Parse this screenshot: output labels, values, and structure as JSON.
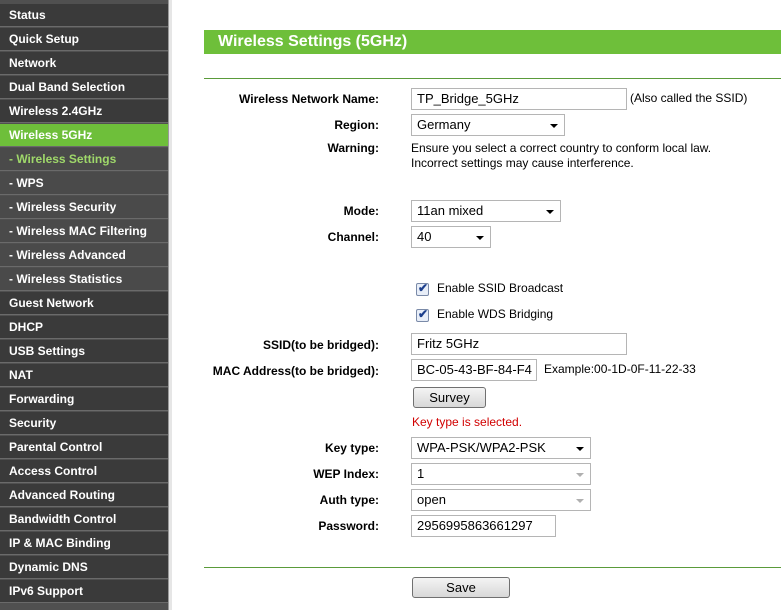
{
  "sidebar": {
    "items": [
      {
        "label": "Status"
      },
      {
        "label": "Quick Setup"
      },
      {
        "label": "Network"
      },
      {
        "label": "Dual Band Selection"
      },
      {
        "label": "Wireless 2.4GHz"
      },
      {
        "label": "Wireless 5GHz"
      },
      {
        "label": "- Wireless Settings"
      },
      {
        "label": "- WPS"
      },
      {
        "label": "- Wireless Security"
      },
      {
        "label": "- Wireless MAC Filtering"
      },
      {
        "label": "- Wireless Advanced"
      },
      {
        "label": "- Wireless Statistics"
      },
      {
        "label": "Guest Network"
      },
      {
        "label": "DHCP"
      },
      {
        "label": "USB Settings"
      },
      {
        "label": "NAT"
      },
      {
        "label": "Forwarding"
      },
      {
        "label": "Security"
      },
      {
        "label": "Parental Control"
      },
      {
        "label": "Access Control"
      },
      {
        "label": "Advanced Routing"
      },
      {
        "label": "Bandwidth Control"
      },
      {
        "label": "IP & MAC Binding"
      },
      {
        "label": "Dynamic DNS"
      },
      {
        "label": "IPv6 Support"
      }
    ]
  },
  "header": {
    "title": "Wireless Settings (5GHz)"
  },
  "form": {
    "ssid": {
      "label": "Wireless Network Name:",
      "value": "TP_Bridge_5GHz",
      "hint": "(Also called the SSID)"
    },
    "region": {
      "label": "Region:",
      "value": "Germany"
    },
    "warning": {
      "label": "Warning:",
      "line1": "Ensure you select a correct country to conform local law.",
      "line2": "Incorrect settings may cause interference."
    },
    "mode": {
      "label": "Mode:",
      "value": "11an mixed"
    },
    "channel": {
      "label": "Channel:",
      "value": "40"
    },
    "ssid_broadcast": {
      "label": "Enable SSID Broadcast",
      "checked": true
    },
    "wds_bridging": {
      "label": "Enable WDS Bridging",
      "checked": true
    },
    "bridged_ssid": {
      "label": "SSID(to be bridged):",
      "value": "Fritz 5GHz"
    },
    "bridged_mac": {
      "label": "MAC Address(to be bridged):",
      "value": "BC-05-43-BF-84-F4",
      "example": "Example:00-1D-0F-11-22-33"
    },
    "survey_button": "Survey",
    "key_status": "Key type is selected.",
    "key_type": {
      "label": "Key type:",
      "value": "WPA-PSK/WPA2-PSK"
    },
    "wep_index": {
      "label": "WEP Index:",
      "value": "1"
    },
    "auth_type": {
      "label": "Auth type:",
      "value": "open"
    },
    "password": {
      "label": "Password:",
      "value": "2956995863661297"
    },
    "save_button": "Save"
  },
  "colors": {
    "accent": "#6ebf3a",
    "sidebar_bg": "#3a3a3a",
    "error": "#d10000"
  }
}
